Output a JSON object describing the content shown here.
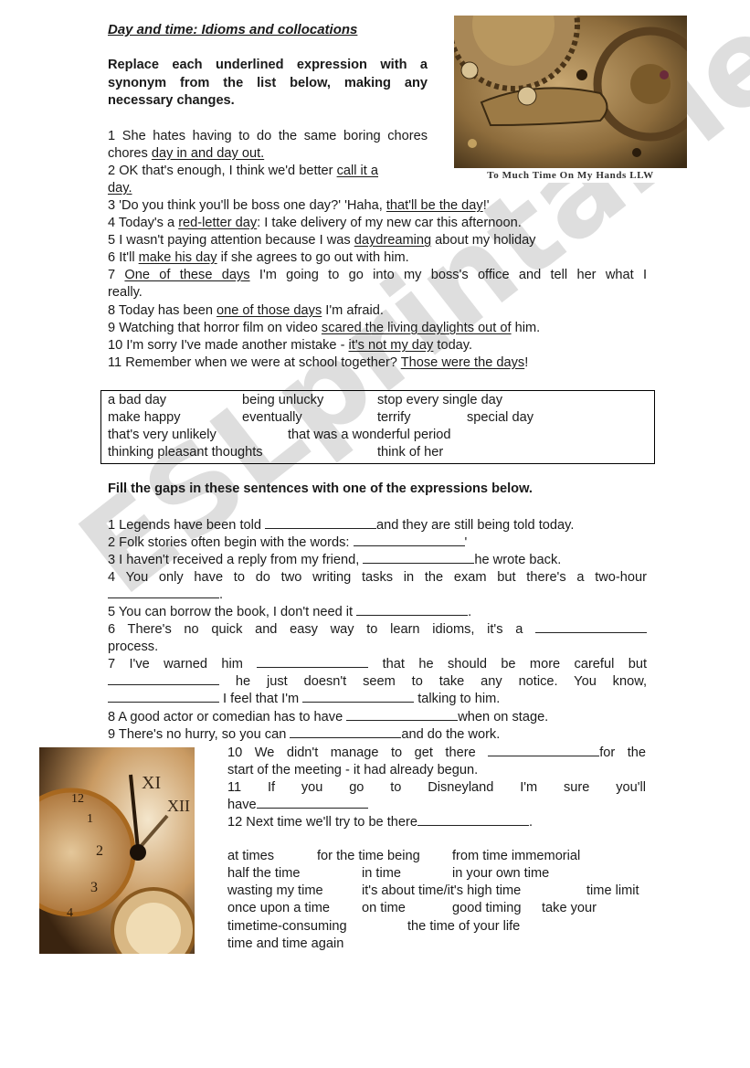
{
  "title": "Day and time: Idioms and collocations",
  "section1": {
    "instruction": "Replace each underlined expression with a synonym from the list below, making any necessary changes.",
    "sentences": [
      {
        "num": "1",
        "before": "She hates having to do the same boring chores ",
        "underlined": "day in and day out.",
        "after": ""
      },
      {
        "num": "2",
        "before": "OK that's enough, I think we'd better ",
        "underlined": "call it a day.",
        "after": ""
      },
      {
        "num": "3",
        "before": "'Do you think you'll be boss one day?' 'Haha, ",
        "underlined": "that'll be the day",
        "after": "!'"
      },
      {
        "num": "4",
        "before": "Today's a ",
        "underlined": "red-letter day",
        "after": ": I take delivery of my new car this afternoon."
      },
      {
        "num": "5",
        "before": "I wasn't paying attention because I was ",
        "underlined": "daydreaming",
        "after": " about my holiday"
      },
      {
        "num": "6",
        "before": "It'll ",
        "underlined": "make his day",
        "after": " if she agrees to go out with him."
      },
      {
        "num": "7",
        "before": "",
        "underlined": "One of these days",
        "after": " I'm going to go into my boss's office and tell her what I really."
      },
      {
        "num": "8",
        "before": "Today has been ",
        "underlined": "one of those days",
        "after": " I'm afraid."
      },
      {
        "num": "9",
        "before": "Watching that horror film on video ",
        "underlined": "scared the living daylights out of",
        "after": " him."
      },
      {
        "num": "10",
        "before": "I'm sorry I've made another mistake - ",
        "underlined": "it's not my day",
        "after": " today."
      },
      {
        "num": "11",
        "before": "Remember when we were at school together? ",
        "underlined": "Those were the days",
        "after": "!"
      }
    ],
    "synonyms": [
      "a bad day",
      "being unlucky",
      "stop every single day",
      "make happy",
      "eventually",
      "terrify",
      "special day",
      "that's very unlikely",
      "that was a wonderful period",
      "thinking pleasant thoughts",
      "think of her"
    ]
  },
  "section2": {
    "instruction": "Fill the gaps in these sentences with one of the expressions below.",
    "sentences": {
      "s1a": "1 Legends have been told ",
      "s1b": "and they are still being told today.",
      "s2a": "2 Folk stories often begin with the words: ",
      "s2b": "'",
      "s3a": "3 I haven't received a reply from my friend, ",
      "s3b": "he wrote back.",
      "s4a": "4 You only have to do two writing tasks in the exam but there's a two-hour",
      "s4b": ".",
      "s5a": "5 You can borrow the book, I don't need it ",
      "s5b": ".",
      "s6a": "6 There's no quick and easy way to learn idioms, it's a",
      "s6b": "process.",
      "s7a": "7 I've warned him",
      "s7b": "that he should be more careful but",
      "s7c": "he just doesn't seem to take any notice. You know,",
      "s7d": " I feel that I'm ",
      "s7e": " talking to him.",
      "s8a": "8 A good actor or comedian has to have ",
      "s8b": "when on stage.",
      "s9a": "9 There's no hurry, so you can ",
      "s9b": "and do the work.",
      "s10a": "10 We didn't manage to get there",
      "s10b": "for the",
      "s10c": "start of the meeting - it had already begun.",
      "s11a": "11 If you go to Disneyland I'm sure you'll",
      "s11b": "have",
      "s12a": "12 Next time we'll try to be there",
      "s12b": "."
    },
    "expressions": [
      "at times",
      "for the time being",
      "from time immemorial",
      "half the time",
      "in time",
      "in your own time",
      "wasting my time",
      "it's about time/it's high time",
      "time limit",
      "once upon a time",
      "on time",
      "good timing",
      "take your",
      "timetime-consuming",
      "the time of your life",
      "time and time again"
    ]
  },
  "images": {
    "clockwork_caption": "To Much Time On My Hands    LLW",
    "clockwork_icon": "clockwork-gears-photo",
    "pocketwatch_icon": "pocket-watches-photo"
  },
  "watermark": "ESLprintables.com",
  "colors": {
    "text": "#1a1a1a",
    "photo_bronze": "#8a6a3a",
    "watermark": "#a0a0a0"
  }
}
